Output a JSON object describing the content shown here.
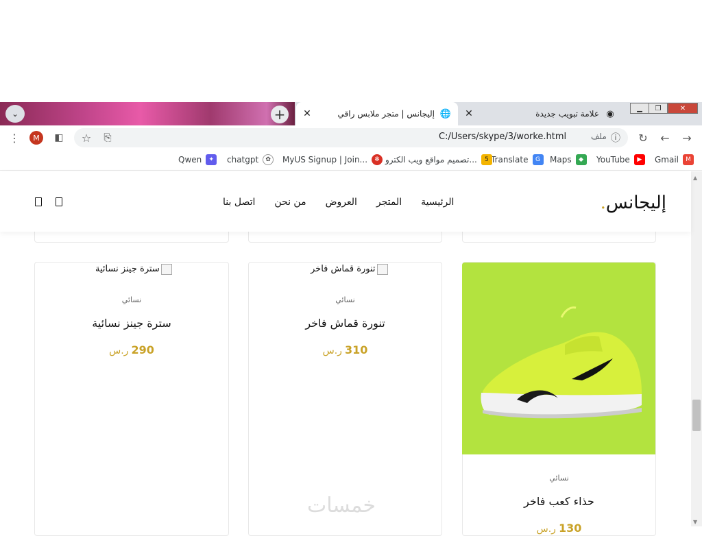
{
  "browser": {
    "tabs": [
      {
        "title": "إليجانس | متجر ملابس راقي",
        "active": true
      },
      {
        "title": "علامة تبويب جديدة",
        "active": false
      }
    ],
    "address": {
      "url": "C:/Users/skype/3/worke.html",
      "file_label": "ملف"
    },
    "profile_initial": "M",
    "bookmarks": [
      {
        "label": "Gmail",
        "icon": "gmail-icon",
        "color": "#ea4335"
      },
      {
        "label": "YouTube",
        "icon": "youtube-icon",
        "color": "#ff0000"
      },
      {
        "label": "Maps",
        "icon": "maps-icon",
        "color": "#34a853"
      },
      {
        "label": "Translate",
        "icon": "translate-icon",
        "color": "#4285f4"
      },
      {
        "label": "تصميم مواقع ويب الكترو...",
        "icon": "five-icon",
        "color": "#f4b400"
      },
      {
        "label": "MyUS Signup | Join...",
        "icon": "myus-icon",
        "color": "#d93025"
      },
      {
        "label": "chatgpt",
        "icon": "openai-icon",
        "color": "#444444"
      },
      {
        "label": "Qwen",
        "icon": "qwen-icon",
        "color": "#615ced"
      }
    ]
  },
  "site": {
    "logo": "إليجانس",
    "logo_dot": ".",
    "accent": "#c9a227",
    "nav": [
      "الرئيسية",
      "المتجر",
      "العروض",
      "من نحن",
      "اتصل بنا"
    ]
  },
  "products": [
    {
      "alt": "حذاء كعب فاخر",
      "category": "نسائي",
      "name": "حذاء كعب فاخر",
      "price": "130",
      "currency": "ر.س",
      "image_color": "#b3e33f"
    },
    {
      "alt": "تنورة قماش فاخر",
      "category": "نسائي",
      "name": "تنورة قماش فاخر",
      "price": "310",
      "currency": "ر.س"
    },
    {
      "alt": "سترة جينز نسائية",
      "category": "نسائي",
      "name": "سترة جينز نسائية",
      "price": "290",
      "currency": "ر.س"
    }
  ],
  "watermark": "خمسات"
}
